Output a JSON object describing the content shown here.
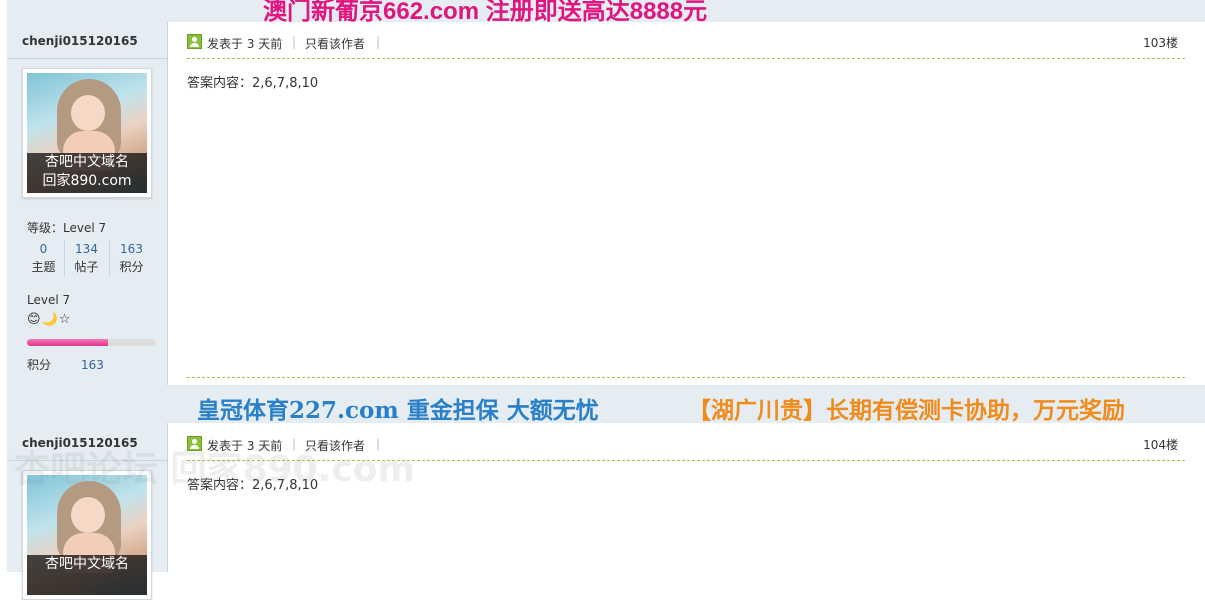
{
  "banners": {
    "top_ad": "澳门新葡京662.com 注册即送高达8888元",
    "mid_ad_left": "皇冠体育227.com 重金担保 大额无忧",
    "mid_ad_right": "【湖广川贵】长期有偿测卡协助，万元奖励"
  },
  "posts": [
    {
      "username": "chenji015120165",
      "avatar_caption_1": "杏吧中文域名",
      "avatar_caption_2": "回家890.com",
      "level_label": "等级：",
      "level_value": "Level 7",
      "stats": [
        {
          "num": "0",
          "label": "主题"
        },
        {
          "num": "134",
          "label": "帖子"
        },
        {
          "num": "163",
          "label": "积分"
        }
      ],
      "rank_title": "Level 7",
      "rank_icons": "😊🌙☆",
      "points_label": "积分",
      "points_value": "163",
      "points_progress": 0.63,
      "posted": "发表于 3 天前",
      "pipe": "|",
      "author_only": "只看该作者",
      "floor": "103楼",
      "content": "答案内容：2,6,7,8,10"
    },
    {
      "username": "chenji015120165",
      "avatar_caption_1": "杏吧中文域名",
      "posted": "发表于 3 天前",
      "pipe": "|",
      "author_only": "只看该作者",
      "floor": "104楼",
      "content": "答案内容：2,6,7,8,10"
    }
  ],
  "watermark": "杏吧论坛 回家890.com",
  "colors": {
    "panel_bg": "#e5edf2",
    "ad_pink": "#e0157f",
    "ad_blue": "#2a80c8",
    "ad_orange": "#f08c1e",
    "link_blue": "#336699",
    "divider_green": "#a3c44c"
  }
}
